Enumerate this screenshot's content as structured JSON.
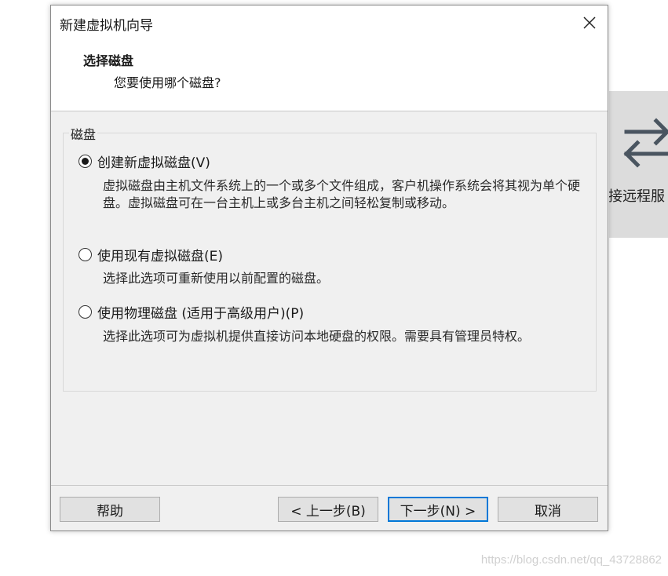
{
  "dialog": {
    "title": "新建虚拟机向导",
    "heading": "选择磁盘",
    "subheading": "您要使用哪个磁盘?",
    "group_label": "磁盘",
    "options": [
      {
        "label": "创建新虚拟磁盘(V)",
        "checked": true,
        "description": "虚拟磁盘由主机文件系统上的一个或多个文件组成，客户机操作系统会将其视为单个硬盘。虚拟磁盘可在一台主机上或多台主机之间轻松复制或移动。"
      },
      {
        "label": "使用现有虚拟磁盘(E)",
        "checked": false,
        "description": "选择此选项可重新使用以前配置的磁盘。"
      },
      {
        "label": "使用物理磁盘 (适用于高级用户)(P)",
        "checked": false,
        "description": "选择此选项可为虚拟机提供直接访问本地硬盘的权限。需要具有管理员特权。"
      }
    ],
    "buttons": {
      "help": "帮助",
      "back": "< 上一步(B)",
      "next": "下一步(N) >",
      "cancel": "取消"
    }
  },
  "background": {
    "tile_label": "接远程服",
    "icon": "swap-arrows-icon"
  },
  "watermark": "https://blog.csdn.net/qq_43728862"
}
